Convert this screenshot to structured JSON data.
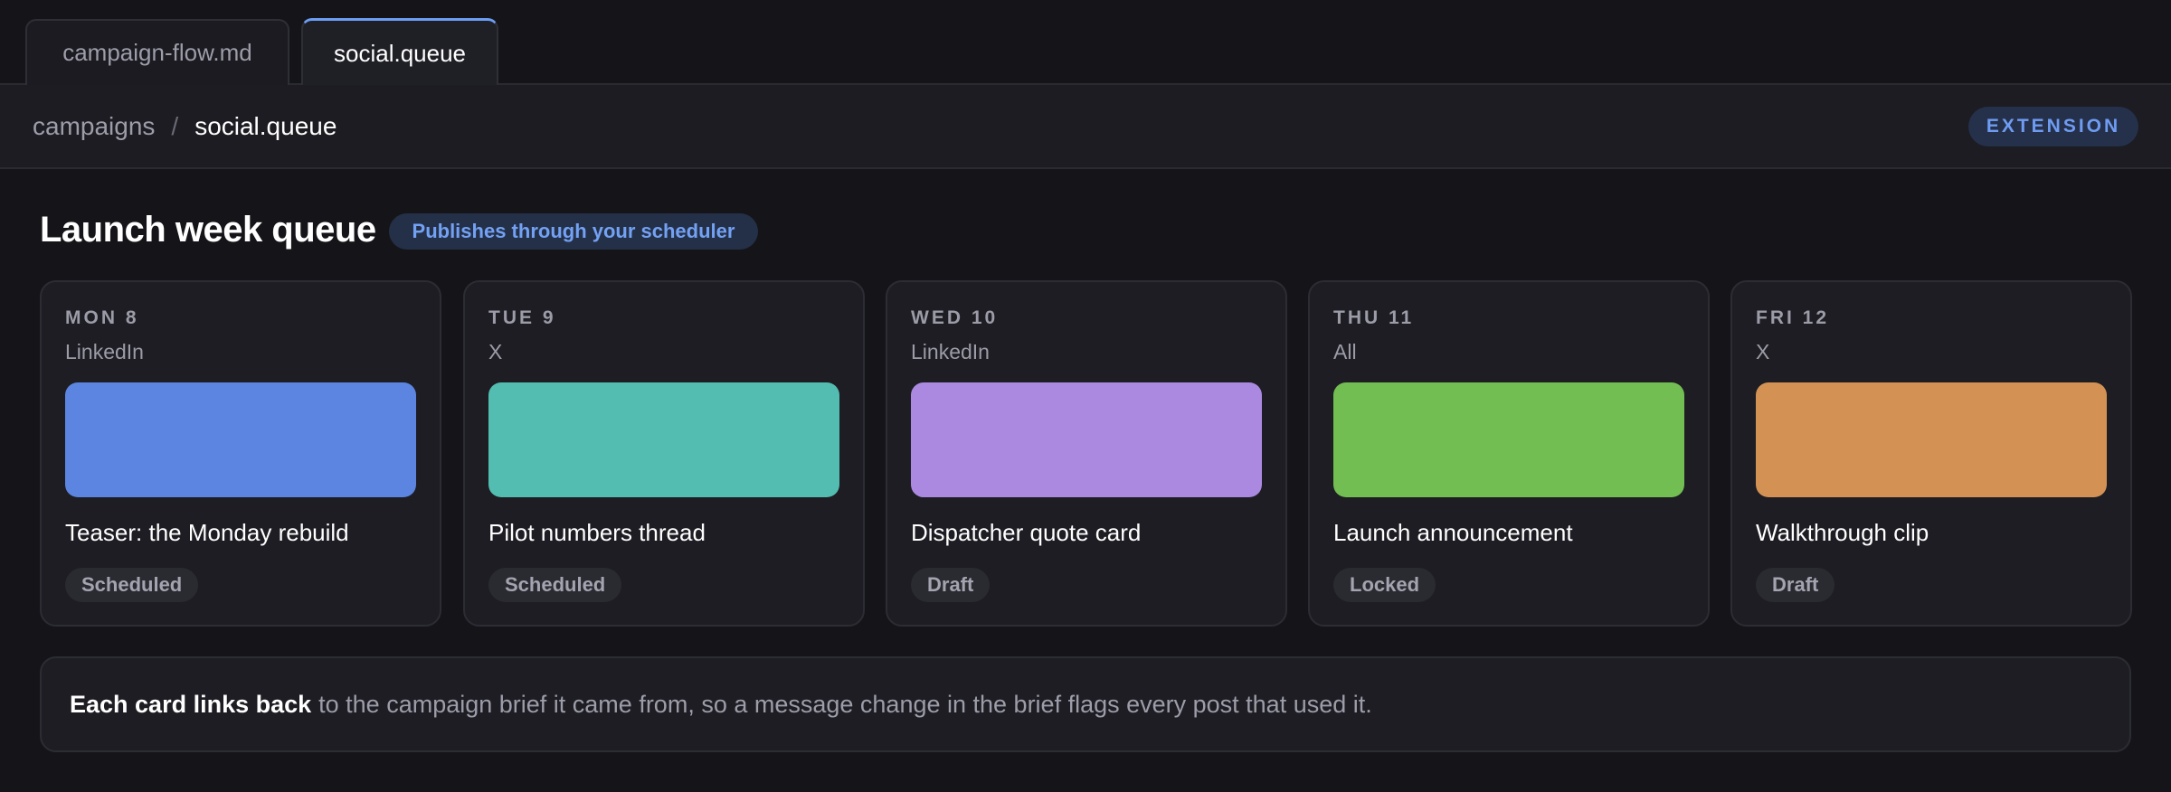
{
  "tabs": [
    {
      "label": "campaign-flow.md",
      "active": false
    },
    {
      "label": "social.queue",
      "active": true
    }
  ],
  "breadcrumb": {
    "parent": "campaigns",
    "separator": "/",
    "current": "social.queue"
  },
  "extension_badge": "EXTENSION",
  "main": {
    "heading": "Launch week queue",
    "publish_badge": "Publishes through your scheduler",
    "cards": [
      {
        "day": "MON 8",
        "channel": "LinkedIn",
        "title": "Teaser: the Monday rebuild",
        "status": "Scheduled",
        "color": "#5b85e0"
      },
      {
        "day": "TUE 9",
        "channel": "X",
        "title": "Pilot numbers thread",
        "status": "Scheduled",
        "color": "#52bdb0"
      },
      {
        "day": "WED 10",
        "channel": "LinkedIn",
        "title": "Dispatcher quote card",
        "status": "Draft",
        "color": "#ab89e1"
      },
      {
        "day": "THU 11",
        "channel": "All",
        "title": "Launch announcement",
        "status": "Locked",
        "color": "#72be52"
      },
      {
        "day": "FRI 12",
        "channel": "X",
        "title": "Walkthrough clip",
        "status": "Draft",
        "color": "#d39254"
      }
    ],
    "note": {
      "bold": "Each card links back",
      "text": "to the campaign brief it came from, so a message change in the brief flags every post that used it."
    }
  }
}
